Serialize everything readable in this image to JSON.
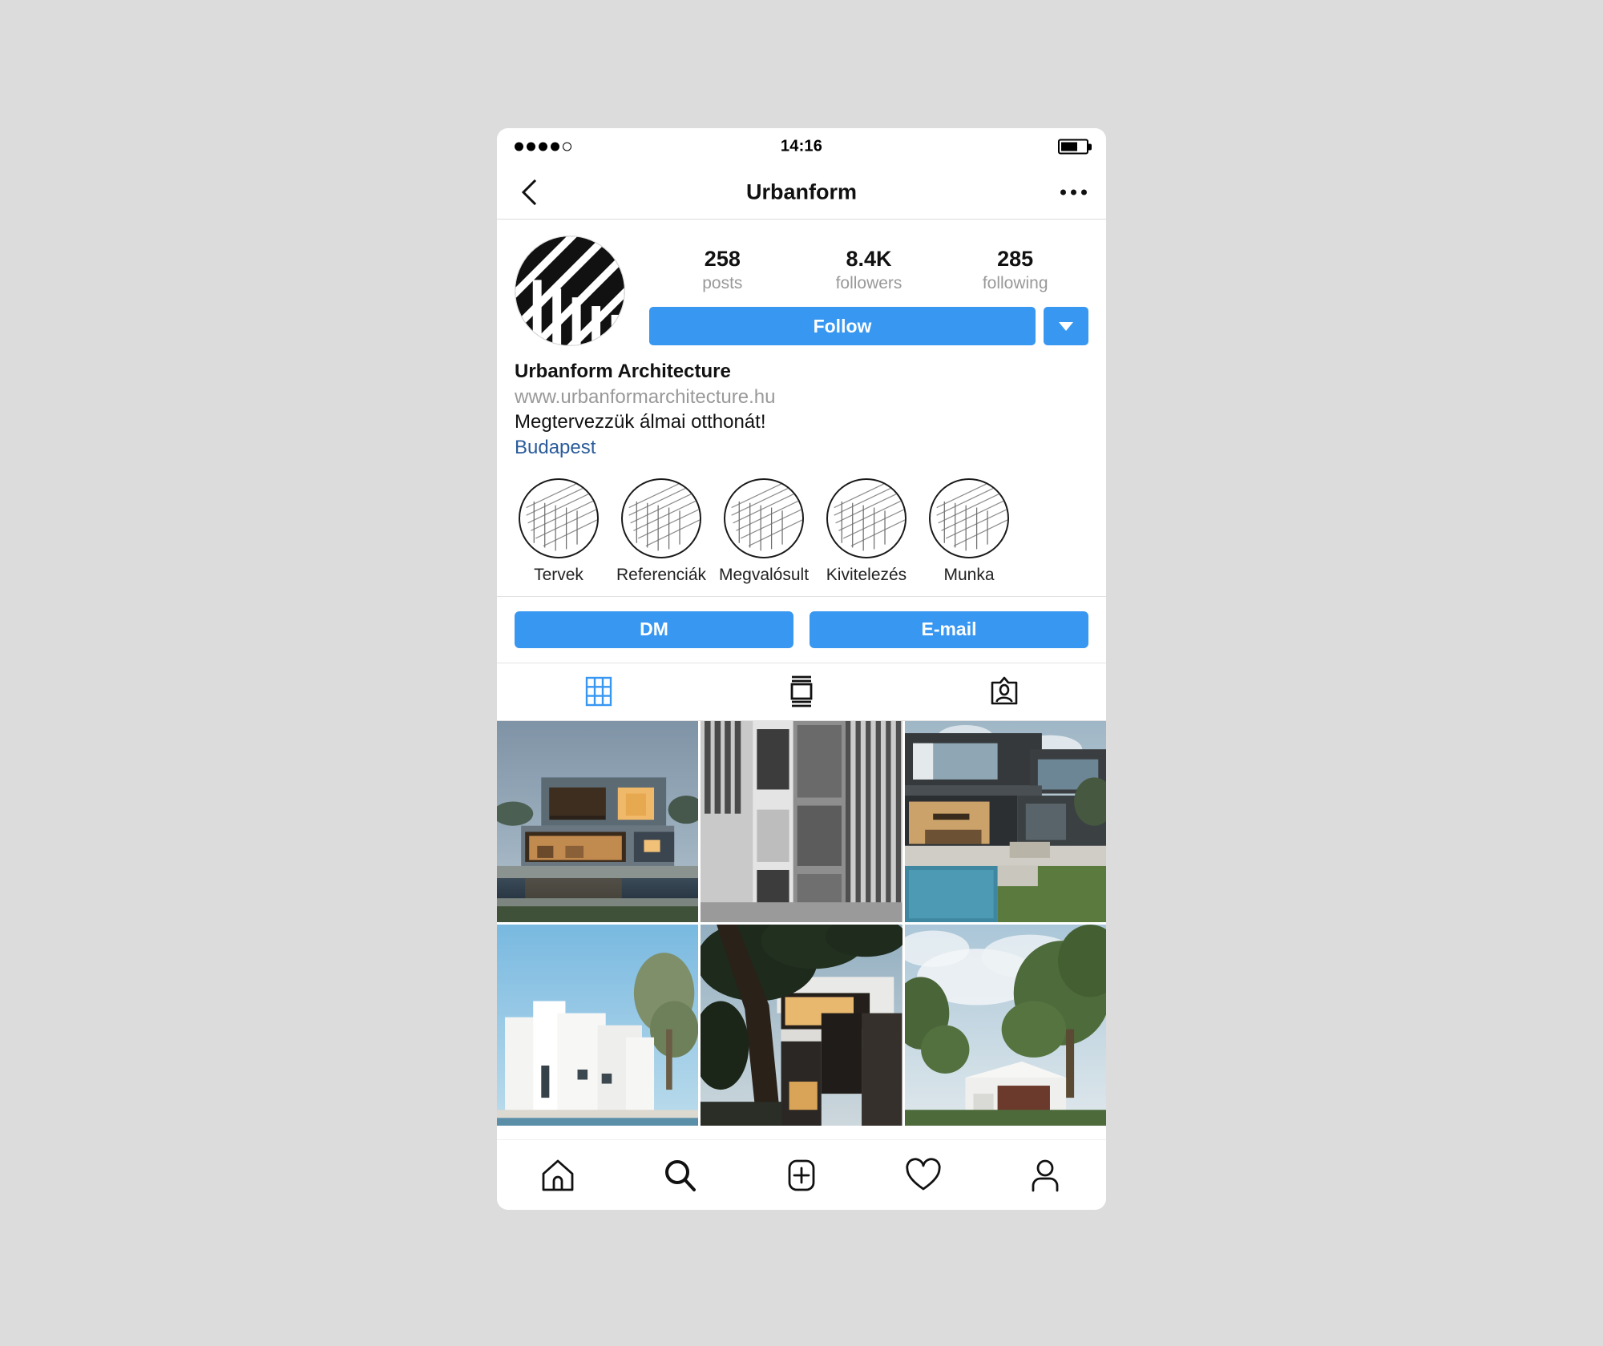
{
  "statusbar": {
    "time": "14:16",
    "signal_dots_total": 5,
    "signal_dots_filled": 4,
    "battery_percent": 65
  },
  "navbar": {
    "back_icon": "chevron-left-icon",
    "title": "Urbanform",
    "more_icon": "more-options-icon"
  },
  "profile": {
    "avatar_icon": "urbanform-logo-avatar",
    "stats": [
      {
        "value": "258",
        "label": "posts"
      },
      {
        "value": "8.4K",
        "label": "followers"
      },
      {
        "value": "285",
        "label": "following"
      }
    ],
    "follow_label": "Follow",
    "caret_icon": "chevron-down-icon",
    "bio": {
      "name": "Urbanform Architecture",
      "url": "www.urbanformarchitecture.hu",
      "text": "Megtervezzük álmai otthonát!",
      "location": "Budapest"
    }
  },
  "highlights": [
    {
      "label": "Tervek",
      "icon": "architecture-sketch-icon"
    },
    {
      "label": "Referenciák",
      "icon": "architecture-sketch-icon"
    },
    {
      "label": "Megvalósult",
      "icon": "architecture-sketch-icon"
    },
    {
      "label": "Kivitelezés",
      "icon": "architecture-sketch-icon"
    },
    {
      "label": "Munka",
      "icon": "architecture-sketch-icon"
    }
  ],
  "contact": {
    "dm_label": "DM",
    "email_label": "E-mail"
  },
  "view_tabs": [
    {
      "name": "grid-view-tab",
      "icon": "grid-icon",
      "active": true
    },
    {
      "name": "list-view-tab",
      "icon": "feed-list-icon",
      "active": false
    },
    {
      "name": "tagged-view-tab",
      "icon": "tagged-person-icon",
      "active": false
    }
  ],
  "bottom_nav": [
    {
      "name": "home-nav",
      "icon": "home-icon"
    },
    {
      "name": "search-nav",
      "icon": "search-icon"
    },
    {
      "name": "add-post-nav",
      "icon": "plus-square-icon"
    },
    {
      "name": "activity-nav",
      "icon": "heart-icon"
    },
    {
      "name": "profile-nav",
      "icon": "person-icon"
    }
  ],
  "grid_photos": [
    {
      "alt": "Modern house at dusk with reflecting pool",
      "style": "dusk-pool-house"
    },
    {
      "alt": "Grayscale building facade with vertical louvers",
      "style": "gray-facade"
    },
    {
      "alt": "Dark modern villa with pool and glass balcony",
      "style": "dark-villa-pool"
    },
    {
      "alt": "White minimalist house with pine tree",
      "style": "white-house-pine"
    },
    {
      "alt": "Modern house behind tree at dusk",
      "style": "tree-dusk-house"
    },
    {
      "alt": "House with trees under cloudy sky",
      "style": "cloudy-tree-house"
    }
  ],
  "colors": {
    "accent_blue": "#3897f0",
    "link_blue": "#2a5b9b",
    "page_background": "#dcdcdc",
    "muted_gray": "#999999",
    "divider": "#e2e2e2"
  }
}
